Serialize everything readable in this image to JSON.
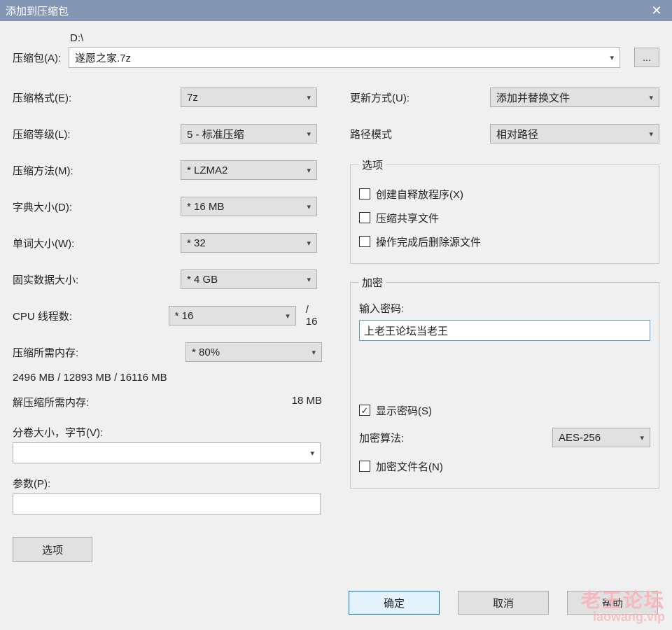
{
  "title": "添加到压缩包",
  "archive": {
    "label": "压缩包(A):",
    "drive": "D:\\",
    "filename": "遂愿之家.7z",
    "browse_label": "..."
  },
  "left": {
    "format": {
      "label": "压缩格式(E):",
      "value": "7z"
    },
    "level": {
      "label": "压缩等级(L):",
      "value": "5 - 标准压缩"
    },
    "method": {
      "label": "压缩方法(M):",
      "value": "* LZMA2"
    },
    "dict": {
      "label": "字典大小(D):",
      "value": "* 16 MB"
    },
    "word": {
      "label": "单词大小(W):",
      "value": "* 32"
    },
    "solid": {
      "label": "固实数据大小:",
      "value": "* 4 GB"
    },
    "threads": {
      "label": "CPU 线程数:",
      "value": "* 16",
      "max": "/ 16"
    },
    "mem_enc": {
      "label": "压缩所需内存:",
      "value": "2496 MB / 12893 MB / 16116 MB",
      "limit": "* 80%"
    },
    "mem_dec": {
      "label": "解压缩所需内存:",
      "value": "18 MB"
    },
    "volume": {
      "label": "分卷大小，字节(V):"
    },
    "params": {
      "label": "参数(P):"
    },
    "options_button": "选项"
  },
  "right": {
    "update": {
      "label": "更新方式(U):",
      "value": "添加并替换文件"
    },
    "pathmode": {
      "label": "路径模式",
      "value": "相对路径"
    },
    "options_group": {
      "legend": "选项",
      "sfx": "创建自释放程序(X)",
      "shared": "压缩共享文件",
      "delete": "操作完成后删除源文件"
    },
    "encrypt_group": {
      "legend": "加密",
      "pw_label": "输入密码:",
      "pw_value": "上老王论坛当老王",
      "show_pw": "显示密码(S)",
      "alg_label": "加密算法:",
      "alg_value": "AES-256",
      "enc_names": "加密文件名(N)"
    }
  },
  "buttons": {
    "ok": "确定",
    "cancel": "取消",
    "help": "帮助"
  },
  "watermark": {
    "line1": "老王论坛",
    "line2": "laowang.vip"
  }
}
